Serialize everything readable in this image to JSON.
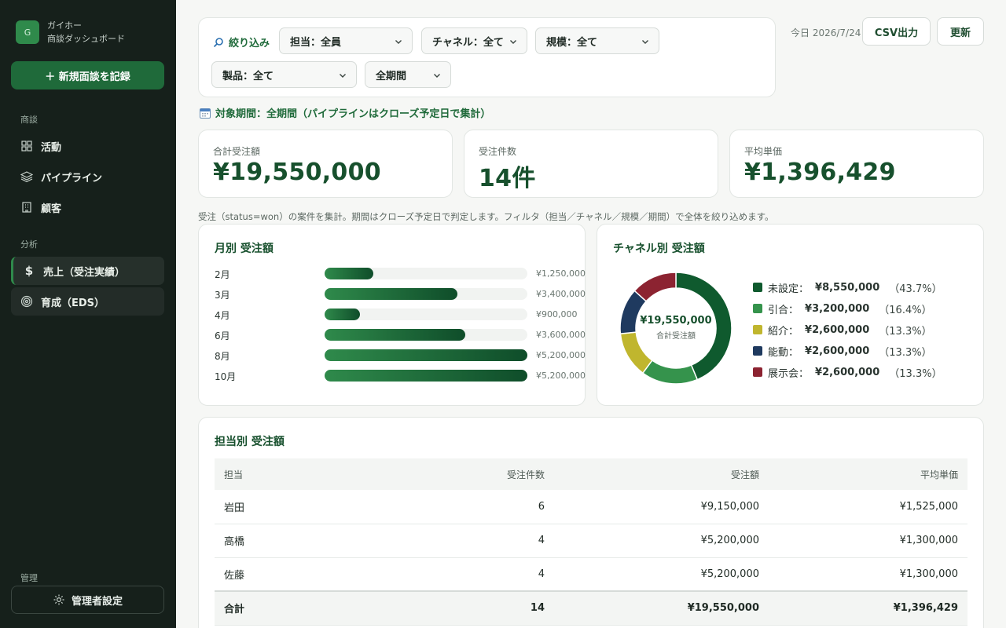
{
  "sidebar": {
    "logo_letter": "G",
    "brand_name": "ガイホー",
    "brand_sub": "商談ダッシュボード",
    "new_button": "＋ 新規面談を記録",
    "section_deals": "商談",
    "items": [
      {
        "label": "活動",
        "icon": "grid-icon"
      },
      {
        "label": "パイプライン",
        "icon": "layers-icon"
      },
      {
        "label": "顧客",
        "icon": "building-icon"
      }
    ],
    "section_analysis": "分析",
    "analysis_items": [
      {
        "label": "売上（受注実績）",
        "icon": "dollar-icon"
      },
      {
        "label": "育成（EDS）",
        "icon": "target-icon"
      }
    ],
    "section_admin": "管理",
    "admin_button": "管理者設定"
  },
  "filters": {
    "label": "絞り込み",
    "owner": "担当：全員",
    "channel": "チャネル：全て",
    "scale": "規模：全て",
    "product": "製品：全て",
    "period": "全期間"
  },
  "toolbar": {
    "today": "今日 2026/7/24",
    "csv": "CSV出力",
    "refresh": "更新"
  },
  "period_note": "対象期間：全期間（パイプラインはクローズ予定日で集計）",
  "kpis": [
    {
      "label": "合計受注額",
      "value": "¥19,550,000"
    },
    {
      "label": "受注件数",
      "value": "14件"
    },
    {
      "label": "平均単価",
      "value": "¥1,396,429"
    }
  ],
  "note": "受注（status=won）の案件を集計。期間はクローズ予定日で判定します。フィルタ（担当／チャネル／規模／期間）で全体を絞り込めます。",
  "monthly": {
    "title": "月別 受注額"
  },
  "channel": {
    "title": "チャネル別 受注額",
    "center_value": "¥19,550,000",
    "center_label": "合計受注額"
  },
  "chart_data": [
    {
      "type": "bar",
      "orientation": "horizontal",
      "title": "月別 受注額",
      "categories": [
        "2月",
        "3月",
        "4月",
        "6月",
        "8月",
        "10月"
      ],
      "values": [
        1250000,
        3400000,
        900000,
        3600000,
        5200000,
        5200000
      ],
      "value_labels": [
        "¥1,250,000",
        "¥3,400,000",
        "¥900,000",
        "¥3,600,000",
        "¥5,200,000",
        "¥5,200,000"
      ],
      "max": 5200000
    },
    {
      "type": "pie",
      "donut": true,
      "title": "チャネル別 受注額",
      "categories": [
        "未設定",
        "引合",
        "紹介",
        "能動",
        "展示会"
      ],
      "values": [
        8550000,
        3200000,
        2600000,
        2600000,
        2600000
      ],
      "value_labels": [
        "¥8,550,000",
        "¥3,200,000",
        "¥2,600,000",
        "¥2,600,000",
        "¥2,600,000"
      ],
      "percent_labels": [
        "（43.7%）",
        "（16.4%）",
        "（13.3%）",
        "（13.3%）",
        "（13.3%）"
      ],
      "colors": [
        "#0f5a2e",
        "#35934c",
        "#c0b62e",
        "#1f3a5f",
        "#8c2331"
      ]
    }
  ],
  "owners": {
    "title": "担当別 受注額",
    "headers": [
      "担当",
      "受注件数",
      "受注額",
      "平均単価"
    ],
    "rows": [
      [
        "岩田",
        "6",
        "¥9,150,000",
        "¥1,525,000"
      ],
      [
        "高橋",
        "4",
        "¥5,200,000",
        "¥1,300,000"
      ],
      [
        "佐藤",
        "4",
        "¥5,200,000",
        "¥1,300,000"
      ]
    ],
    "total": [
      "合計",
      "14",
      "¥19,550,000",
      "¥1,396,429"
    ]
  }
}
